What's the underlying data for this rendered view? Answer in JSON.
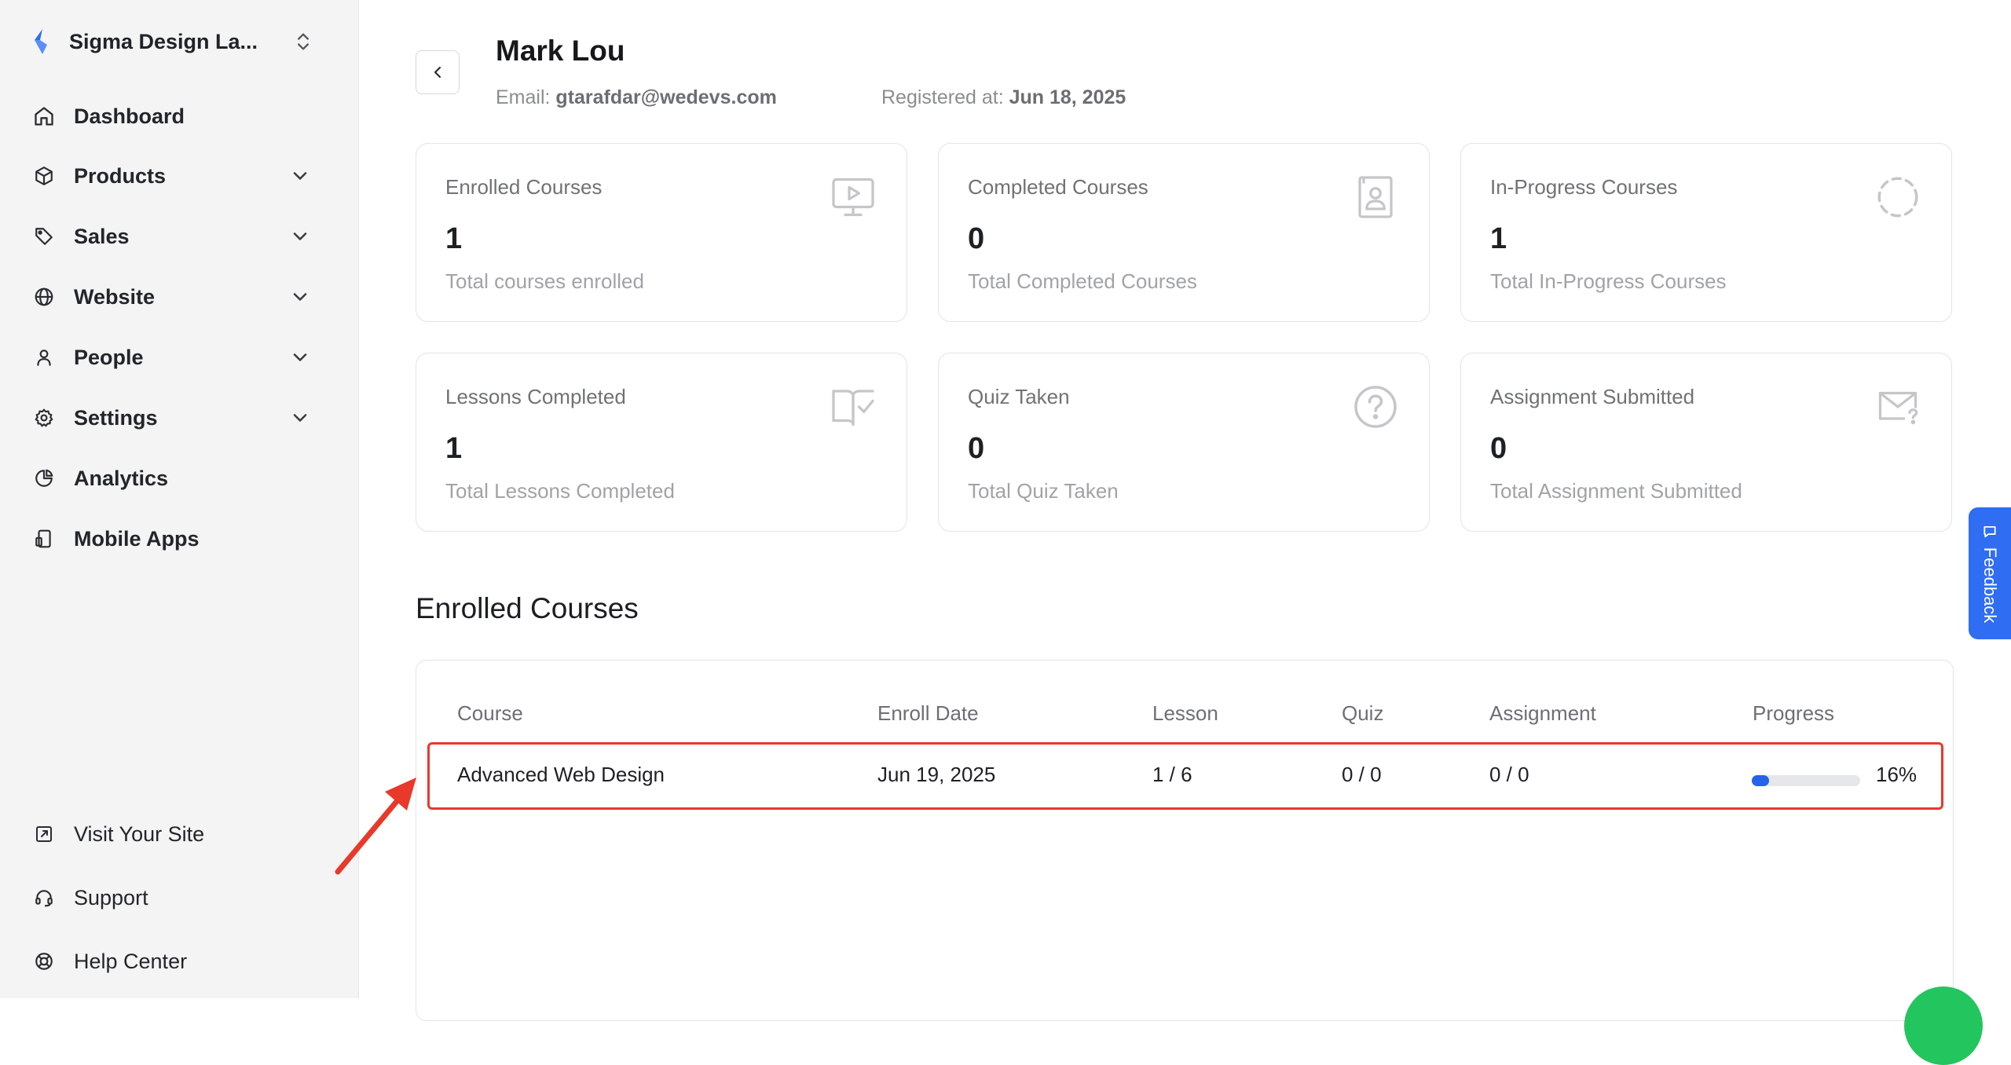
{
  "sidebar": {
    "brand_name": "Sigma Design La...",
    "brand_color": "#2f6df2",
    "nav": [
      {
        "label": "Dashboard",
        "icon": "home-icon",
        "expandable": false
      },
      {
        "label": "Products",
        "icon": "box-icon",
        "expandable": true
      },
      {
        "label": "Sales",
        "icon": "tag-icon",
        "expandable": true
      },
      {
        "label": "Website",
        "icon": "globe-icon",
        "expandable": true
      },
      {
        "label": "People",
        "icon": "user-icon",
        "expandable": true
      },
      {
        "label": "Settings",
        "icon": "gear-icon",
        "expandable": true
      },
      {
        "label": "Analytics",
        "icon": "pie-chart-icon",
        "expandable": false
      },
      {
        "label": "Mobile Apps",
        "icon": "mobile-icon",
        "expandable": false
      }
    ],
    "bottom": [
      {
        "label": "Visit Your Site",
        "icon": "external-link-icon"
      },
      {
        "label": "Support",
        "icon": "headset-icon"
      },
      {
        "label": "Help Center",
        "icon": "lifebuoy-icon"
      }
    ]
  },
  "profile": {
    "name": "Mark Lou",
    "email_label": "Email:",
    "email": "gtarafdar@wedevs.com",
    "registered_label": "Registered at:",
    "registered": "Jun 18, 2025"
  },
  "stats": [
    {
      "title": "Enrolled Courses",
      "value": "1",
      "sub": "Total courses enrolled",
      "icon": "monitor-play-icon"
    },
    {
      "title": "Completed Courses",
      "value": "0",
      "sub": "Total Completed Courses",
      "icon": "certificate-icon"
    },
    {
      "title": "In-Progress Courses",
      "value": "1",
      "sub": "Total In-Progress Courses",
      "icon": "dashed-circle-icon"
    },
    {
      "title": "Lessons Completed",
      "value": "1",
      "sub": "Total Lessons Completed",
      "icon": "book-check-icon"
    },
    {
      "title": "Quiz Taken",
      "value": "0",
      "sub": "Total Quiz Taken",
      "icon": "question-circle-icon"
    },
    {
      "title": "Assignment Submitted",
      "value": "0",
      "sub": "Total Assignment Submitted",
      "icon": "mail-question-icon"
    }
  ],
  "enrolled": {
    "title": "Enrolled Courses",
    "columns": [
      "Course",
      "Enroll Date",
      "Lesson",
      "Quiz",
      "Assignment",
      "Progress"
    ],
    "rows": [
      {
        "course": "Advanced Web Design",
        "enroll_date": "Jun 19, 2025",
        "lesson": "1 / 6",
        "quiz": "0 / 0",
        "assignment": "0 / 0",
        "progress_text": "16%",
        "progress": 0.16
      }
    ],
    "highlight_color": "#e8392a",
    "progress_color": "#2563eb"
  },
  "feedback": {
    "label": "Feedback",
    "color": "#2f6df2"
  }
}
